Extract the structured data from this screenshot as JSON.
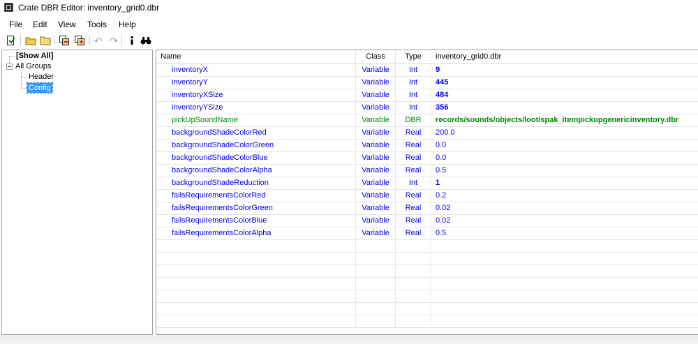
{
  "window": {
    "title": "Crate DBR Editor: inventory_grid0.dbr"
  },
  "menu": {
    "items": [
      "File",
      "Edit",
      "View",
      "Tools",
      "Help"
    ]
  },
  "tree": {
    "show_all": "[Show All]",
    "all_groups": "All Groups",
    "header": "Header",
    "config": "Config"
  },
  "grid": {
    "columns": {
      "name": "Name",
      "class": "Class",
      "type": "Type",
      "value": "inventory_grid0.dbr"
    },
    "rows": [
      {
        "name": "inventoryX",
        "class": "Variable",
        "type": "Int",
        "value": "9",
        "style": "int"
      },
      {
        "name": "inventoryY",
        "class": "Variable",
        "type": "Int",
        "value": "445",
        "style": "int"
      },
      {
        "name": "inventoryXSize",
        "class": "Variable",
        "type": "Int",
        "value": "484",
        "style": "int"
      },
      {
        "name": "inventoryYSize",
        "class": "Variable",
        "type": "Int",
        "value": "356",
        "style": "int"
      },
      {
        "name": "pickUpSoundName",
        "class": "Variable",
        "type": "DBR",
        "value": "records/sounds/objects/loot/spak_itempickupgenericinventory.dbr",
        "style": "dbr"
      },
      {
        "name": "backgroundShadeColorRed",
        "class": "Variable",
        "type": "Real",
        "value": "200.0",
        "style": "real"
      },
      {
        "name": "backgroundShadeColorGreen",
        "class": "Variable",
        "type": "Real",
        "value": "0.0",
        "style": "real"
      },
      {
        "name": "backgroundShadeColorBlue",
        "class": "Variable",
        "type": "Real",
        "value": "0.0",
        "style": "real"
      },
      {
        "name": "backgroundShadeColorAlpha",
        "class": "Variable",
        "type": "Real",
        "value": "0.5",
        "style": "real"
      },
      {
        "name": "backgroundShadeReduction",
        "class": "Variable",
        "type": "Int",
        "value": "1",
        "style": "int"
      },
      {
        "name": "failsRequirementsColorRed",
        "class": "Variable",
        "type": "Real",
        "value": "0.2",
        "style": "real"
      },
      {
        "name": "failsRequirementsColorGreen",
        "class": "Variable",
        "type": "Real",
        "value": "0.02",
        "style": "real"
      },
      {
        "name": "failsRequirementsColorBlue",
        "class": "Variable",
        "type": "Real",
        "value": "0.02",
        "style": "real"
      },
      {
        "name": "failsRequirementsColorAlpha",
        "class": "Variable",
        "type": "Real",
        "value": "0.5",
        "style": "real"
      }
    ],
    "empty_row_count": 7
  },
  "colors": {
    "int": "#0000ee",
    "dbr": "#008a00",
    "real": "#0000ee",
    "selection": "#3399ff"
  },
  "toolbar_icons": [
    "new-record-icon",
    "open-folder-icon",
    "open-directory-icon",
    "copy-record-icon",
    "paste-record-icon",
    "undo-icon",
    "redo-icon",
    "info-icon",
    "find-icon"
  ]
}
